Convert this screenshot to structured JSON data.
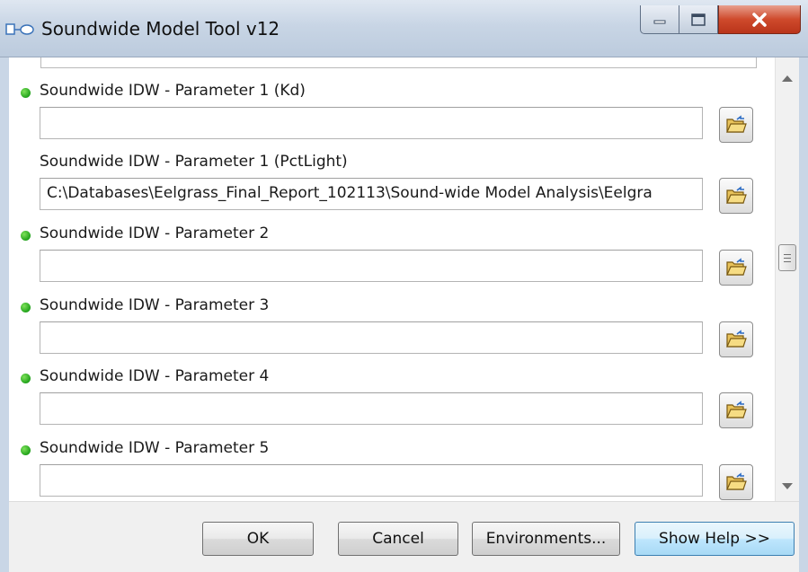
{
  "window": {
    "title": "Soundwide Model Tool v12",
    "icon": "model-tool-icon"
  },
  "parameters": [
    {
      "label": "Soundwide IDW - Parameter 1 (Kd)",
      "value": "",
      "required": true
    },
    {
      "label": "Soundwide IDW - Parameter 1 (PctLight)",
      "value": "C:\\Databases\\Eelgrass_Final_Report_102113\\Sound-wide Model Analysis\\Eelgra",
      "required": false
    },
    {
      "label": "Soundwide IDW - Parameter 2",
      "value": "",
      "required": true
    },
    {
      "label": "Soundwide IDW - Parameter 3",
      "value": "",
      "required": true
    },
    {
      "label": "Soundwide IDW - Parameter 4",
      "value": "",
      "required": true
    },
    {
      "label": "Soundwide IDW - Parameter 5",
      "value": "",
      "required": true
    }
  ],
  "buttons": {
    "ok": "OK",
    "cancel": "Cancel",
    "environments": "Environments...",
    "show_help": "Show Help >>"
  },
  "icons": {
    "browse": "folder-open-icon",
    "required": "green-dot-icon"
  }
}
